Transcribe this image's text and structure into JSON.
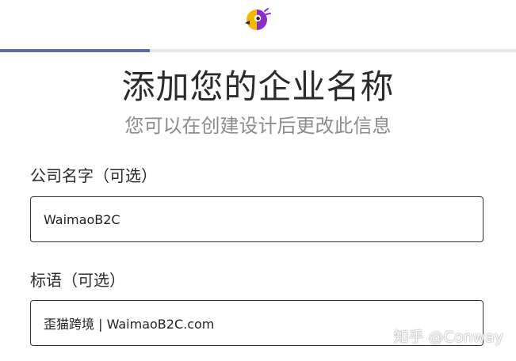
{
  "header": {
    "logo_icon": "parrot-logo-icon",
    "progress_percent": 29
  },
  "main": {
    "title": "添加您的企业名称",
    "subtitle": "您可以在创建设计后更改此信息"
  },
  "form": {
    "company_name": {
      "label": "公司名字（可选）",
      "value": "WaimaoB2C"
    },
    "slogan": {
      "label": "标语（可选）",
      "value": "歪猫跨境 | WaimaoB2C.com"
    }
  },
  "watermark": {
    "text": "知乎 @Conway"
  },
  "colors": {
    "progress_fill": "#5a6ba8",
    "progress_track": "#e4e6ea",
    "logo_yellow": "#f5b800",
    "logo_purple": "#8a2ec8"
  }
}
